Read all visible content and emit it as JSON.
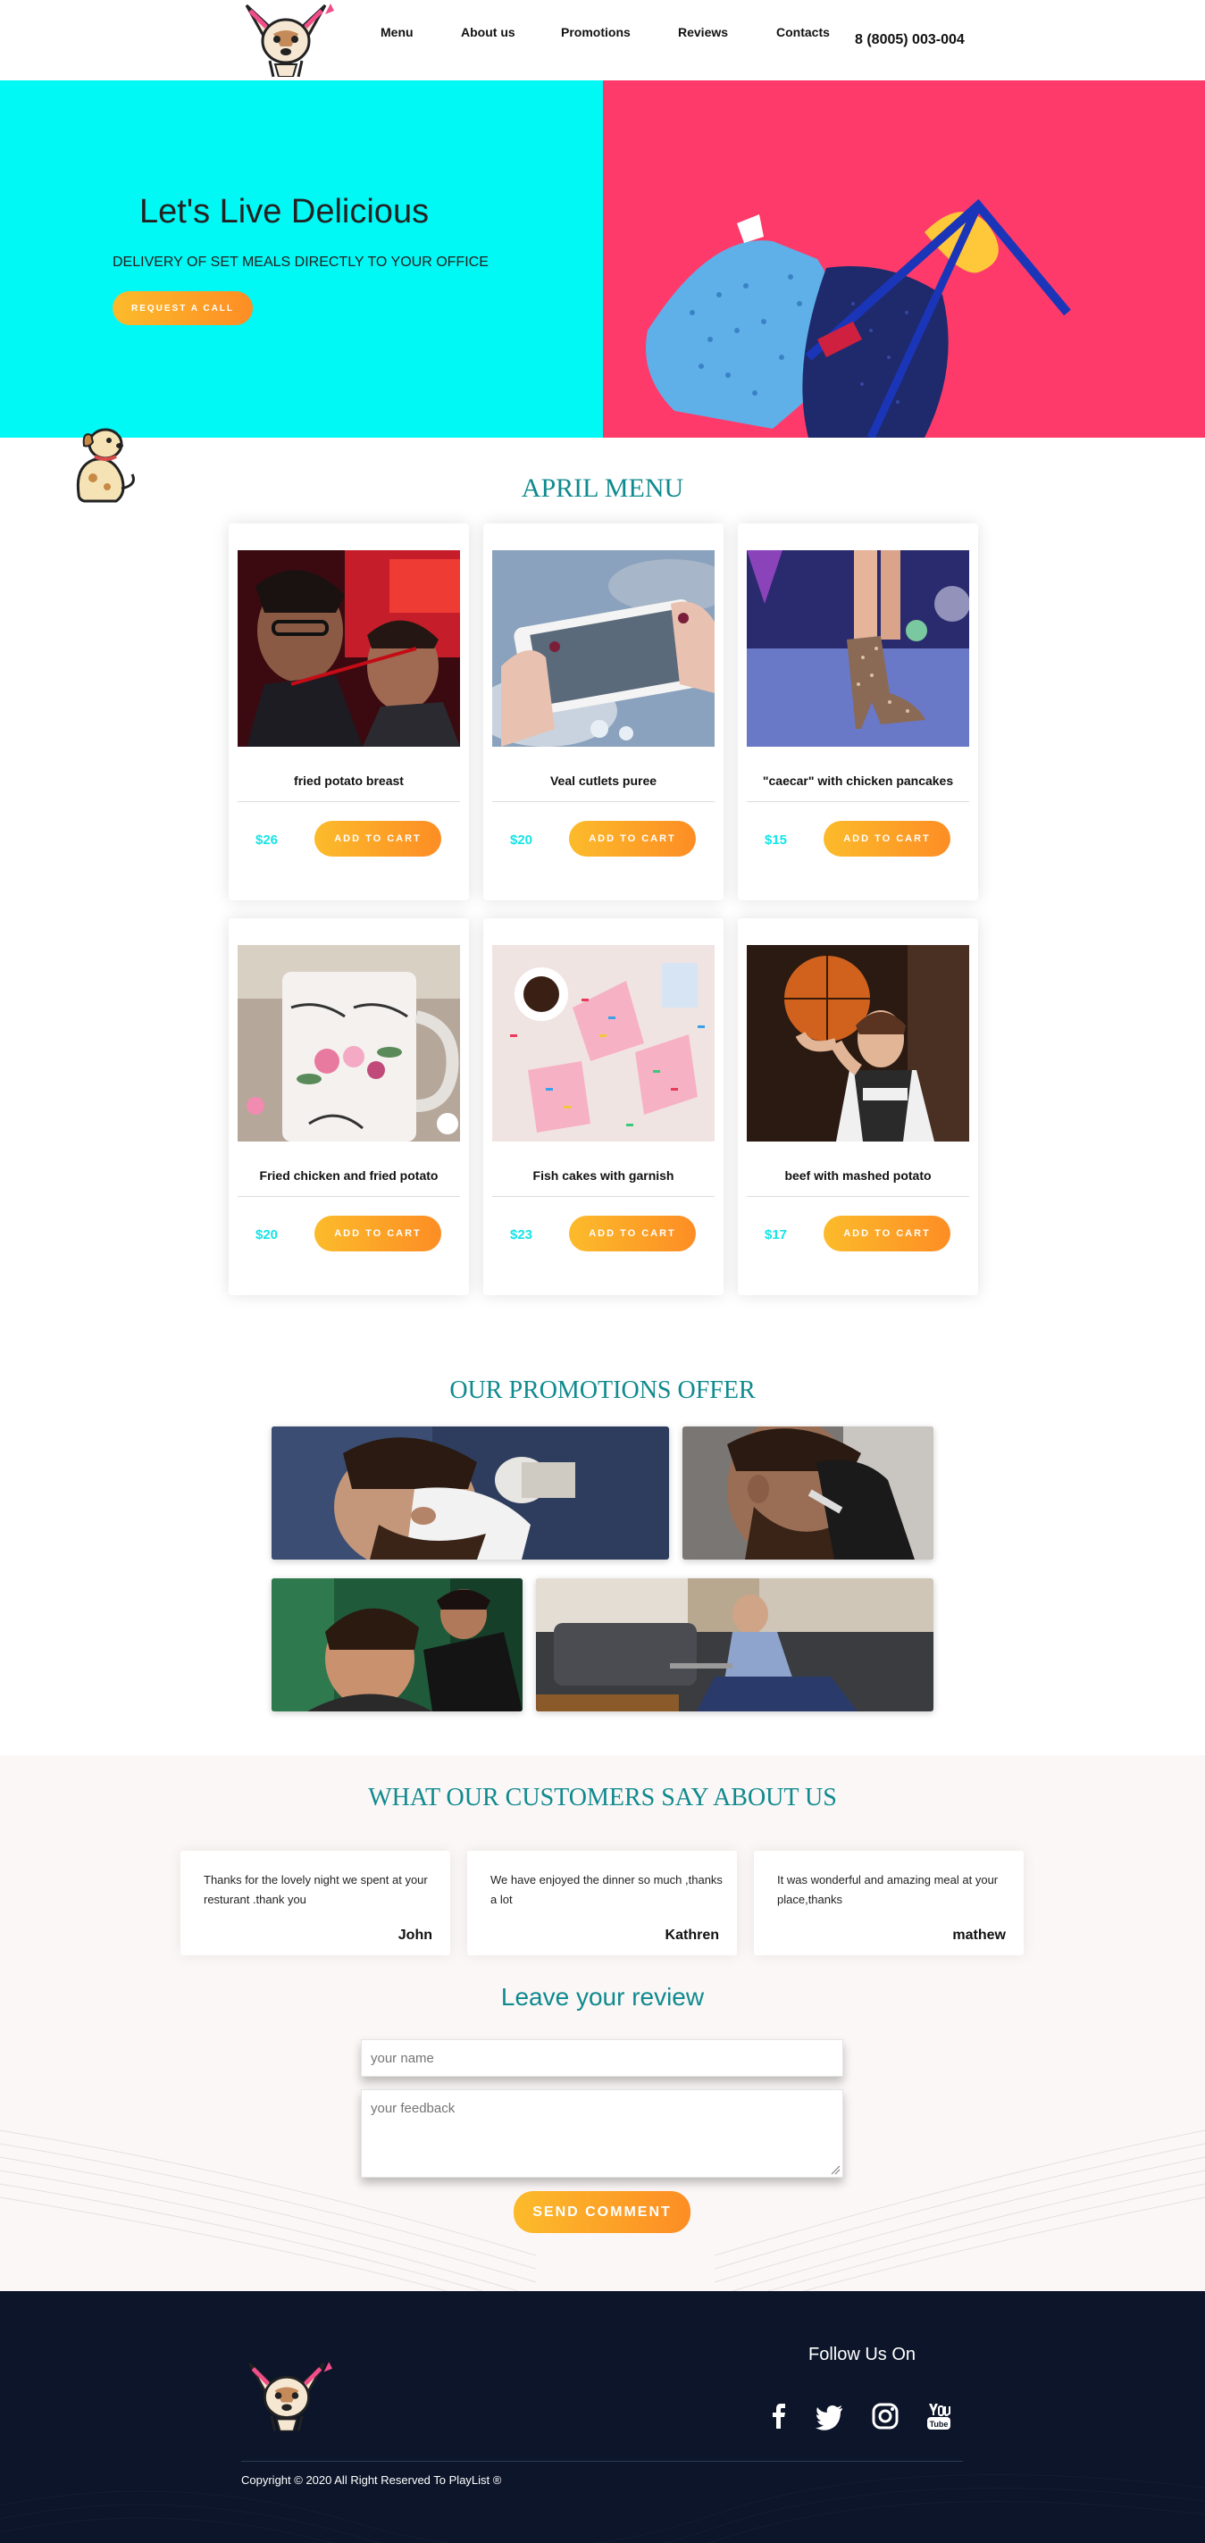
{
  "header": {
    "nav": [
      "Menu",
      "About us",
      "Promotions",
      "Reviews",
      "Contacts"
    ],
    "phone": "8 (8005) 003-004"
  },
  "hero": {
    "title": "Let's Live Delicious",
    "subtitle": "DELIVERY OF SET MEALS DIRECTLY TO YOUR OFFICE",
    "button": "REQUEST A CALL"
  },
  "menu": {
    "title": "APRIL MENU",
    "cart_label": "ADD TO CART",
    "items": [
      {
        "name": "fried potato breast",
        "price": "$26",
        "image": "two-men-party-photo"
      },
      {
        "name": "Veal cutlets puree",
        "price": "$20",
        "image": "phone-photographing-clouds"
      },
      {
        "name": "\"caecar\" with chicken pancakes",
        "price": "$15",
        "image": "glitter-heel-boot"
      },
      {
        "name": "Fried chicken and fried potato",
        "price": "$20",
        "image": "mother-of-the-bride-mug"
      },
      {
        "name": "Fish cakes with garnish",
        "price": "$23",
        "image": "sprinkles-and-coffee"
      },
      {
        "name": "beef with mashed potato",
        "price": "$17",
        "image": "girl-basketball-player"
      }
    ]
  },
  "promotions": {
    "title": "OUR PROMOTIONS OFFER"
  },
  "testimonials": {
    "title": "WHAT OUR CUSTOMERS SAY ABOUT US",
    "items": [
      {
        "text": "Thanks for the lovely night we spent at your resturant .thank you",
        "author": "John"
      },
      {
        "text": "We have enjoyed the dinner so much ,thanks a lot",
        "author": "Kathren"
      },
      {
        "text": "It was wonderful and amazing meal at your place,thanks",
        "author": "mathew"
      }
    ]
  },
  "review_form": {
    "title": "Leave your review",
    "name_placeholder": "your name",
    "feedback_placeholder": "your feedback",
    "submit": "SEND COMMENT"
  },
  "footer": {
    "follow": "Follow Us On",
    "social": [
      "facebook-icon",
      "twitter-icon",
      "instagram-icon",
      "youtube-icon"
    ],
    "copyright": "Copyright © 2020 All Right Reserved To PlayList ®"
  },
  "colors": {
    "hero_left": "#00f8f5",
    "hero_right": "#fe3a6a",
    "accent_teal": "#0f8a8e",
    "button_orange": "#fcbb2b",
    "price_cyan": "#14e4e6",
    "footer_bg": "#0c1529"
  }
}
